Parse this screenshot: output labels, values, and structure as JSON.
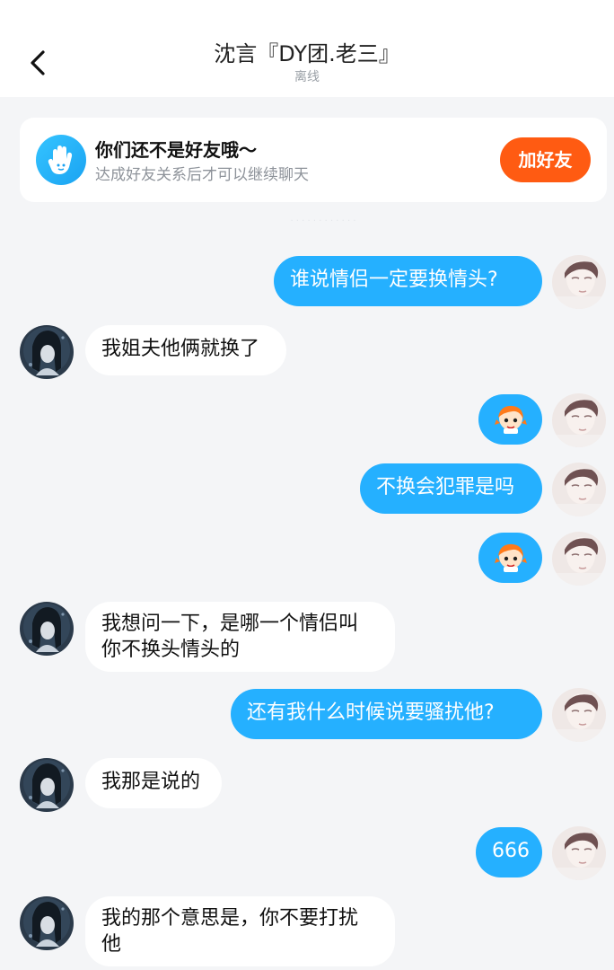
{
  "header": {
    "title": "沈言『DY团.老三』",
    "status": "离线"
  },
  "banner": {
    "title": "你们还不是好友哦～",
    "subtitle": "达成好友关系后才可以继续聊天",
    "button_label": "加好友"
  },
  "colors": {
    "outgoing_bubble": "#25b0ff",
    "incoming_bubble": "#ffffff",
    "add_friend_button": "#ff5b12",
    "background": "#f4f5f7"
  },
  "messages": [
    {
      "side": "out",
      "type": "text",
      "text": "谁说情侣一定要换情头?"
    },
    {
      "side": "in",
      "type": "text",
      "text": "我姐夫他俩就换了"
    },
    {
      "side": "out",
      "type": "sticker",
      "sticker": "cartoon-girl-sticker"
    },
    {
      "side": "out",
      "type": "text",
      "text": "不换会犯罪是吗"
    },
    {
      "side": "out",
      "type": "sticker",
      "sticker": "cartoon-girl-sticker"
    },
    {
      "side": "in",
      "type": "text",
      "text": "我想问一下，是哪一个情侣叫\n你不换头情头的"
    },
    {
      "side": "out",
      "type": "text",
      "text": "还有我什么时候说要骚扰他?"
    },
    {
      "side": "in",
      "type": "text",
      "text": "我那是说的"
    },
    {
      "side": "out",
      "type": "text",
      "text": "666"
    },
    {
      "side": "in",
      "type": "text",
      "text": "我的那个意思是，你不要打扰\n他"
    }
  ]
}
